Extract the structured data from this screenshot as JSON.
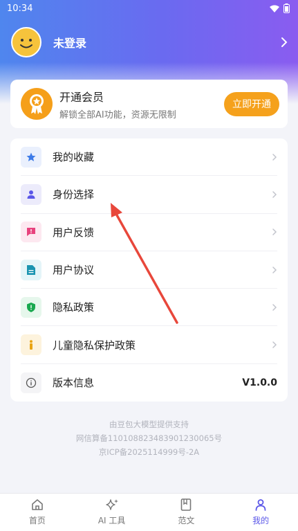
{
  "status_bar": {
    "time": "10:34"
  },
  "profile": {
    "login_text": "未登录"
  },
  "vip": {
    "title": "开通会员",
    "subtitle": "解锁全部AI功能，资源无限制",
    "button_label": "立即开通"
  },
  "menu": {
    "items": [
      {
        "label": "我的收藏",
        "icon": "star-icon",
        "bg": "#eaf0fd",
        "color": "#3d7be8"
      },
      {
        "label": "身份选择",
        "icon": "person-icon",
        "bg": "#ecebfb",
        "color": "#5b57e8"
      },
      {
        "label": "用户反馈",
        "icon": "feedback-icon",
        "bg": "#fde8f0",
        "color": "#e8427d"
      },
      {
        "label": "用户协议",
        "icon": "document-icon",
        "bg": "#e4f5f8",
        "color": "#1a94b0"
      },
      {
        "label": "隐私政策",
        "icon": "shield-icon",
        "bg": "#e6f7ec",
        "color": "#19a84f"
      },
      {
        "label": "儿童隐私保护政策",
        "icon": "child-icon",
        "bg": "#fdf3dd",
        "color": "#e9a414"
      }
    ],
    "version": {
      "label": "版本信息",
      "value": "V1.0.0",
      "icon": "info-icon"
    }
  },
  "footer": {
    "line1": "由豆包大模型提供支持",
    "line2": "网信算备110108823483901230065号",
    "line3": "京ICP备2025114999号-2A"
  },
  "tabs": [
    {
      "label": "首页",
      "icon": "home-icon"
    },
    {
      "label": "AI 工具",
      "icon": "sparkle-icon"
    },
    {
      "label": "范文",
      "icon": "book-icon"
    },
    {
      "label": "我的",
      "icon": "user-icon",
      "active": true
    }
  ],
  "colors": {
    "accent": "#5b57e8",
    "vip_orange": "#f5a11c",
    "annotation_arrow": "#e8473b"
  }
}
